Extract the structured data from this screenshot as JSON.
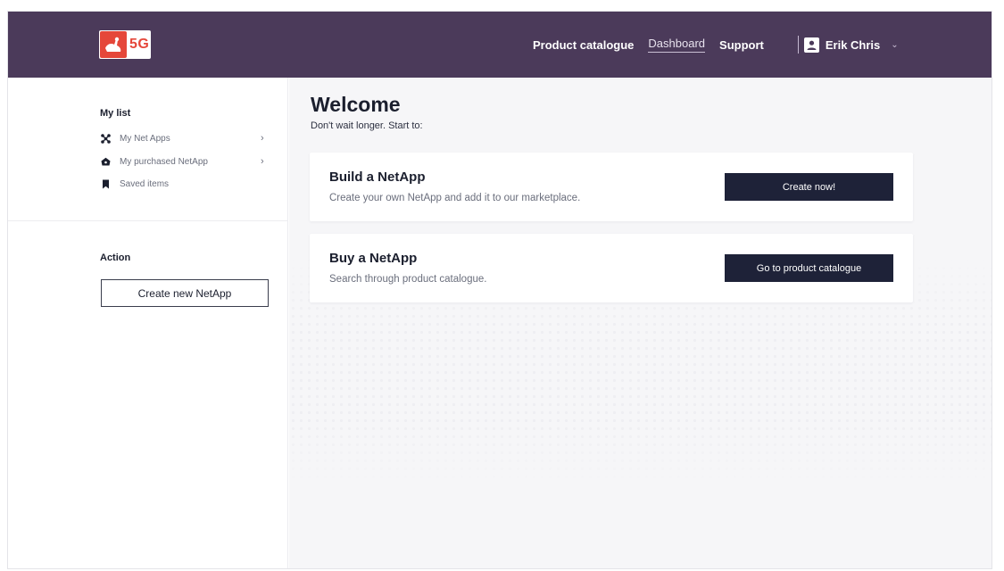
{
  "header": {
    "logo_text": "5G",
    "nav": [
      {
        "label": "Product catalogue",
        "active": false
      },
      {
        "label": "Dashboard",
        "active": true
      },
      {
        "label": "Support",
        "active": false
      }
    ],
    "user_name": "Erik Chris",
    "colors": {
      "header_bg": "#4b3a5a",
      "brand": "#e5473a"
    }
  },
  "sidebar": {
    "my_list_title": "My list",
    "items": [
      {
        "label": "My Net Apps",
        "icon": "network-icon",
        "chevron": true
      },
      {
        "label": "My purchased  NetApp",
        "icon": "cart-icon",
        "chevron": true
      },
      {
        "label": "Saved items",
        "icon": "bookmark-icon",
        "chevron": false
      }
    ],
    "action_title": "Action",
    "create_button": "Create new NetApp"
  },
  "main": {
    "title": "Welcome",
    "subtitle": "Don't wait longer. Start to:",
    "cards": [
      {
        "title": "Build a NetApp",
        "description": "Create your own NetApp and add it to our marketplace.",
        "button": "Create now!"
      },
      {
        "title": "Buy a NetApp",
        "description": "Search through product catalogue.",
        "button": "Go to product catalogue"
      }
    ],
    "colors": {
      "button_bg": "#1e2238",
      "background": "#f6f6f8"
    }
  }
}
